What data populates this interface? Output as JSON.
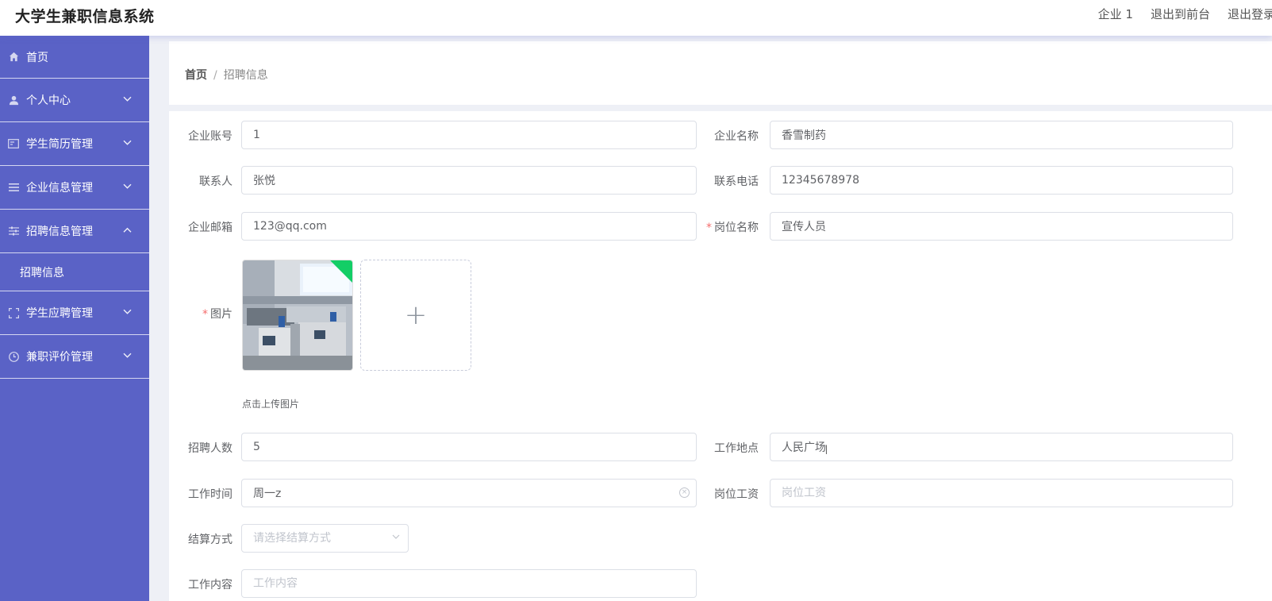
{
  "header": {
    "title": "大学生兼职信息系统",
    "user": "企业 1",
    "to_front": "退出到前台",
    "logout": "退出登录"
  },
  "sidebar": {
    "items": [
      {
        "label": "首页",
        "icon": "home-icon"
      },
      {
        "label": "个人中心",
        "icon": "user-icon"
      },
      {
        "label": "学生简历管理",
        "icon": "resume-icon"
      },
      {
        "label": "企业信息管理",
        "icon": "list-icon"
      },
      {
        "label": "招聘信息管理",
        "icon": "sliders-icon"
      },
      {
        "label": "学生应聘管理",
        "icon": "frame-icon"
      },
      {
        "label": "兼职评价管理",
        "icon": "clock-icon"
      }
    ],
    "sub_items": [
      {
        "label": "招聘信息"
      }
    ]
  },
  "breadcrumb": {
    "home": "首页",
    "separator": "/",
    "current": "招聘信息"
  },
  "form": {
    "company_account": {
      "label": "企业账号",
      "value": "1"
    },
    "company_name": {
      "label": "企业名称",
      "value": "香雪制药"
    },
    "contact": {
      "label": "联系人",
      "value": "张悦"
    },
    "phone": {
      "label": "联系电话",
      "value": "12345678978"
    },
    "email": {
      "label": "企业邮箱",
      "value": "123@qq.com"
    },
    "position": {
      "label": "岗位名称",
      "value": "宣传人员",
      "required": "*"
    },
    "image": {
      "label": "图片",
      "required": "*",
      "tip": "点击上传图片",
      "add_glyph": "+"
    },
    "headcount": {
      "label": "招聘人数",
      "value": "5"
    },
    "location": {
      "label": "工作地点",
      "value": "人民广场"
    },
    "work_time": {
      "label": "工作时间",
      "value": "周一z"
    },
    "salary": {
      "label": "岗位工资",
      "value": "",
      "placeholder": "岗位工资"
    },
    "settlement": {
      "label": "结算方式",
      "value": "",
      "placeholder": "请选择结算方式"
    },
    "content": {
      "label": "工作内容",
      "value": "",
      "placeholder": "工作内容"
    }
  },
  "colors": {
    "sidebar": "#5a62c6",
    "success": "#13ce66",
    "required": "#f56c6c"
  }
}
